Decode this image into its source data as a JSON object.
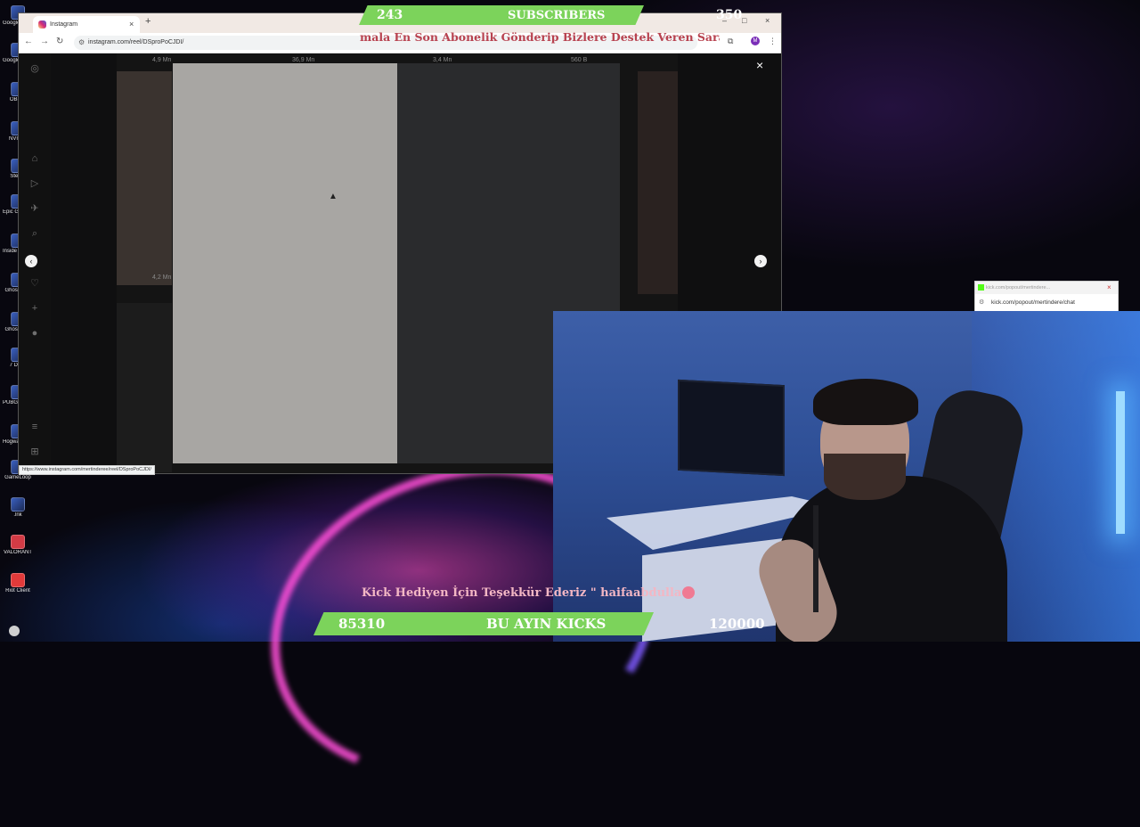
{
  "desktop": {
    "icons": [
      {
        "label": "Google Drive"
      },
      {
        "label": "Google Chrome"
      },
      {
        "label": "OBS S"
      },
      {
        "label": "NVIDIA"
      },
      {
        "label": "Steam"
      },
      {
        "label": "Epic Games Launcher"
      },
      {
        "label": "Inside Backrooms"
      },
      {
        "label": "Ghost Jam"
      },
      {
        "label": "Ghost Jam"
      },
      {
        "label": "7 Days"
      },
      {
        "label": "PUBG BATTLE"
      },
      {
        "label": "Hogwarts Legacy"
      },
      {
        "label": "GameLoop"
      },
      {
        "label": ".lnk"
      },
      {
        "label": "VALORANT"
      },
      {
        "label": "Riot Client"
      }
    ]
  },
  "browser": {
    "tab_title": "Instagram",
    "tab_close": "×",
    "new_tab": "+",
    "url": "instagram.com/reel/DSproPoCJDI/",
    "status_url": "https://www.instagram.com/mertinderee/reel/DSproPoCJDI/",
    "window_controls": {
      "minimize": "–",
      "maximize": "□",
      "close": "×"
    },
    "nav": {
      "back": "←",
      "forward": "→",
      "reload": "↻"
    }
  },
  "instagram": {
    "view_counts": {
      "thumb1": "4,9 Mn",
      "thumb2": "36,9 Mn",
      "thumb3": "3,4 Mn",
      "thumb4": "560 B",
      "thumb5": "4,2 Mn"
    },
    "close_label": "×",
    "prev_label": "‹",
    "next_label": "›"
  },
  "overlay": {
    "subs_current": "243",
    "subs_label": "SUBSCRIBERS",
    "subs_goal": "350",
    "top_ticker": "mala En Son Abonelik Gönderip Bizlere Destek Veren Sara",
    "bottom_ticker": "Kick Hediyen İçin Teşekkür Ederiz \" haifaabdulla \"",
    "kicks_current": "85310",
    "kicks_label": "BU AYIN KICKS",
    "kicks_goal": "120000"
  },
  "chat_popout": {
    "title": "kick.com/popout/mertindere...",
    "url": "kick.com/popout/mertindere/chat"
  }
}
